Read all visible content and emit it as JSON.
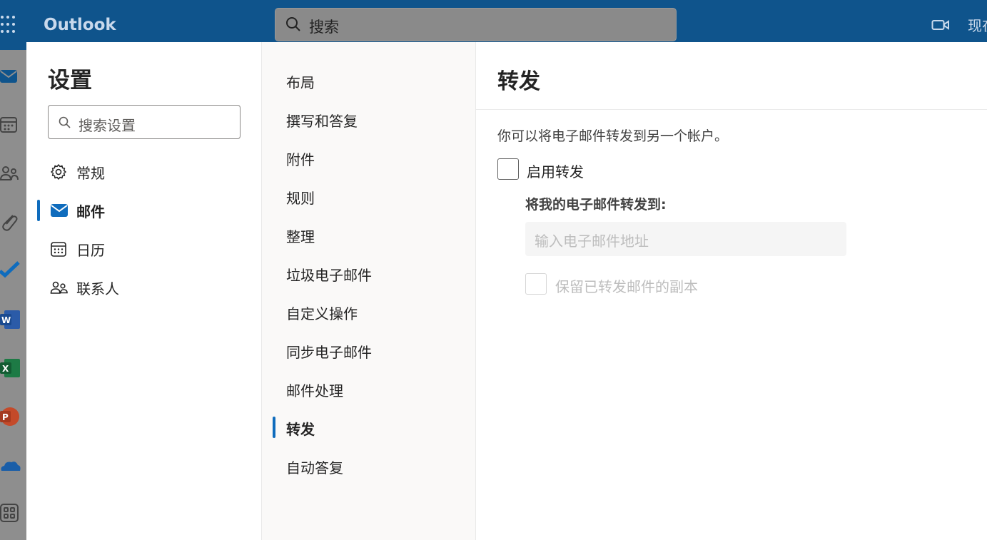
{
  "app": {
    "brand": "Outlook",
    "search_placeholder": "搜索",
    "top_right_text": "现在"
  },
  "rail": {
    "icons": [
      "mail-icon",
      "calendar-icon",
      "people-icon",
      "attachment-icon",
      "todo-icon",
      "word-icon",
      "excel-icon",
      "powerpoint-icon",
      "onedrive-icon",
      "more-apps-icon"
    ]
  },
  "settings": {
    "title": "设置",
    "search_placeholder": "搜索设置",
    "categories": [
      {
        "label": "常规",
        "icon": "gear-icon",
        "selected": false
      },
      {
        "label": "邮件",
        "icon": "mail-icon",
        "selected": true
      },
      {
        "label": "日历",
        "icon": "calendar-icon",
        "selected": false
      },
      {
        "label": "联系人",
        "icon": "people-icon",
        "selected": false
      }
    ],
    "mail_sections": [
      {
        "label": "布局",
        "selected": false
      },
      {
        "label": "撰写和答复",
        "selected": false
      },
      {
        "label": "附件",
        "selected": false
      },
      {
        "label": "规则",
        "selected": false
      },
      {
        "label": "整理",
        "selected": false
      },
      {
        "label": "垃圾电子邮件",
        "selected": false
      },
      {
        "label": "自定义操作",
        "selected": false
      },
      {
        "label": "同步电子邮件",
        "selected": false
      },
      {
        "label": "邮件处理",
        "selected": false
      },
      {
        "label": "转发",
        "selected": true
      },
      {
        "label": "自动答复",
        "selected": false
      }
    ]
  },
  "forwarding": {
    "title": "转发",
    "description": "你可以将电子邮件转发到另一个帐户。",
    "enable_label": "启用转发",
    "enable_checked": false,
    "forward_to_label": "将我的电子邮件转发到:",
    "email_placeholder": "输入电子邮件地址",
    "email_value": "",
    "keep_copy_label": "保留已转发邮件的副本",
    "keep_copy_checked": false,
    "keep_copy_disabled": true
  },
  "colors": {
    "header": "#0f548c",
    "accent": "#0f6cbd"
  }
}
